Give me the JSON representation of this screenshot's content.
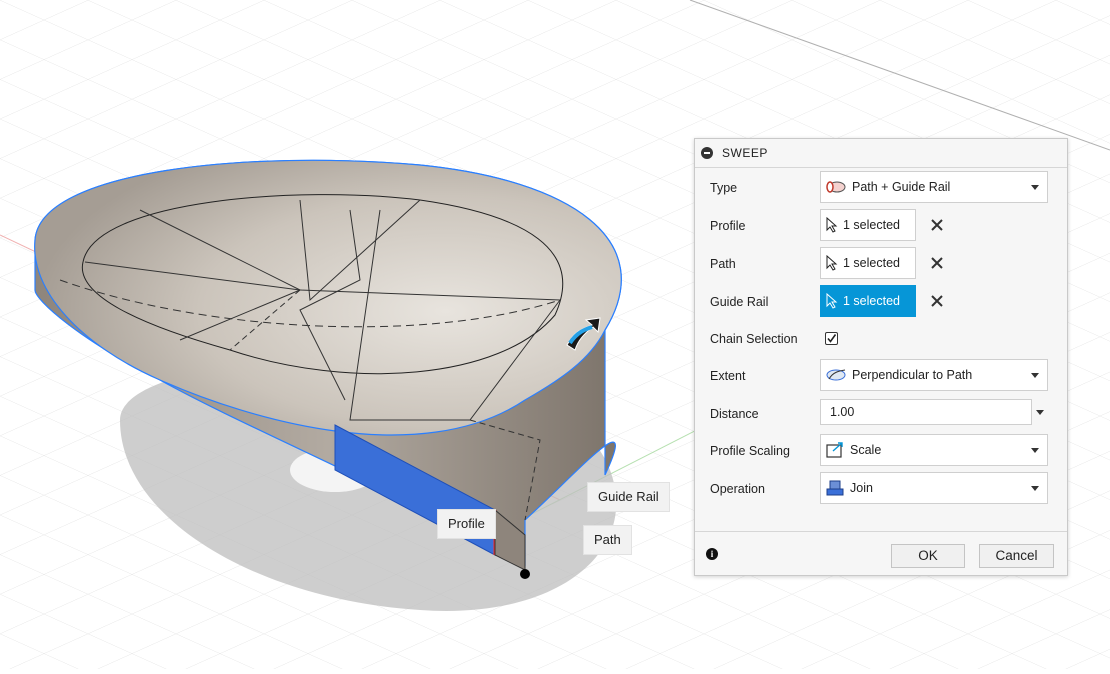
{
  "viewport": {
    "labels": {
      "guide_rail": "Guide Rail",
      "profile": "Profile",
      "path": "Path"
    }
  },
  "dialog": {
    "title": "SWEEP",
    "type": {
      "label": "Type",
      "value": "Path + Guide Rail"
    },
    "profile": {
      "label": "Profile",
      "value": "1 selected"
    },
    "path": {
      "label": "Path",
      "value": "1 selected"
    },
    "guide_rail": {
      "label": "Guide Rail",
      "value": "1 selected"
    },
    "chain_selection": {
      "label": "Chain Selection",
      "checked": true
    },
    "extent": {
      "label": "Extent",
      "value": "Perpendicular to Path"
    },
    "distance": {
      "label": "Distance",
      "value": "1.00"
    },
    "profile_scaling": {
      "label": "Profile Scaling",
      "value": "Scale"
    },
    "operation": {
      "label": "Operation",
      "value": "Join"
    },
    "ok_label": "OK",
    "cancel_label": "Cancel"
  },
  "colors": {
    "accent": "#0696d7",
    "panel_bg": "#f6f6f6",
    "model_face": "#bdb6ae",
    "profile_face": "#3a6fd8",
    "edge_highlight": "#2a7fff"
  }
}
